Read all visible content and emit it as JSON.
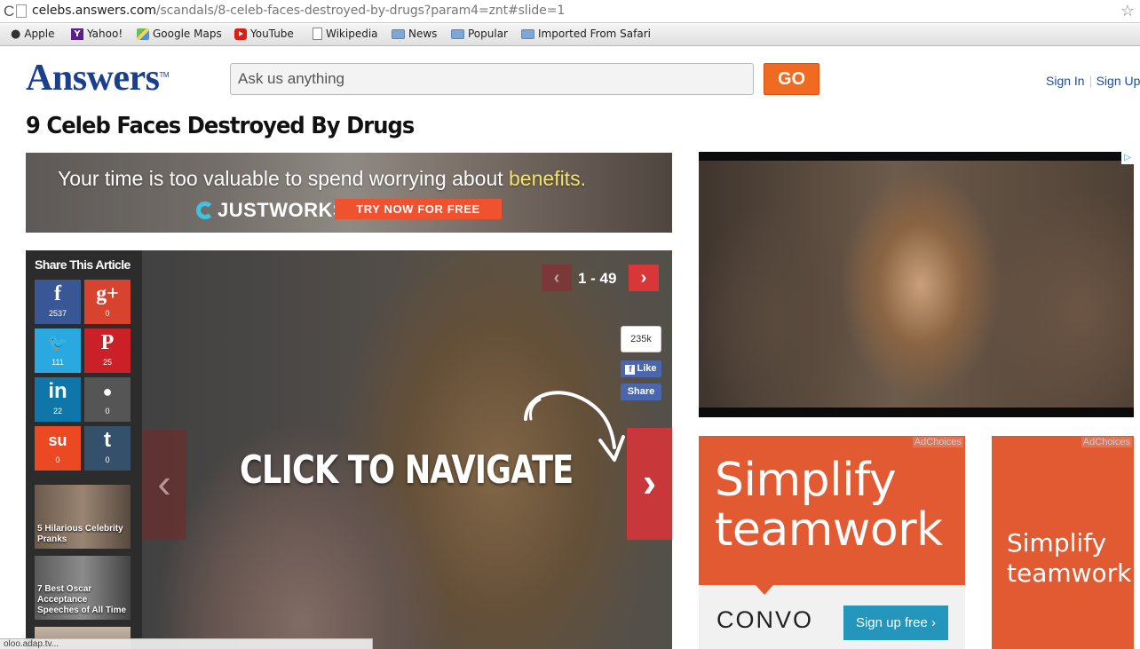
{
  "browser": {
    "url_host": "celebs.answers.com",
    "url_path": "/scandals/8-celeb-faces-destroyed-by-drugs?param4=znt#slide=1",
    "bookmarks": [
      {
        "label": "Apple",
        "icon": "apple-icon"
      },
      {
        "label": "Yahoo!",
        "icon": "yahoo-icon"
      },
      {
        "label": "Google Maps",
        "icon": "maps-icon"
      },
      {
        "label": "YouTube",
        "icon": "youtube-icon"
      },
      {
        "label": "Wikipedia",
        "icon": "page-icon"
      },
      {
        "label": "News",
        "icon": "folder-icon"
      },
      {
        "label": "Popular",
        "icon": "folder-icon"
      },
      {
        "label": "Imported From Safari",
        "icon": "folder-icon"
      }
    ],
    "status_text": "oloo.adap.tv..."
  },
  "header": {
    "logo": "Answers",
    "logo_tm": "TM",
    "search_placeholder": "Ask us anything",
    "go_label": "GO",
    "sign_in": "Sign In",
    "sign_up": "Sign Up"
  },
  "article": {
    "title": "9 Celeb Faces Destroyed By Drugs"
  },
  "banner_ad": {
    "headline_start": "Your time is too valuable to spend worrying about",
    "headline_highlight": "benefits.",
    "brand": "JUSTWORKS",
    "cta": "TRY NOW FOR FREE"
  },
  "slideshow": {
    "share_label": "Share This Article",
    "share": [
      {
        "name": "facebook",
        "glyph": "f",
        "count": "2537"
      },
      {
        "name": "google-plus",
        "glyph": "g+",
        "count": "0"
      },
      {
        "name": "twitter",
        "glyph": "🐦",
        "count": "111"
      },
      {
        "name": "pinterest",
        "glyph": "P",
        "count": "25"
      },
      {
        "name": "linkedin",
        "glyph": "in",
        "count": "22"
      },
      {
        "name": "reddit",
        "glyph": "●",
        "count": "0"
      },
      {
        "name": "stumbleupon",
        "glyph": "su",
        "count": "0"
      },
      {
        "name": "tumblr",
        "glyph": "t",
        "count": "0"
      }
    ],
    "related": [
      {
        "caption": "5 Hilarious Celebrity Pranks"
      },
      {
        "caption": "7 Best Oscar Acceptance Speeches of All Time"
      }
    ],
    "counter": "1 - 49",
    "prev_glyph": "‹",
    "next_glyph": "›",
    "fb_like_count": "235k",
    "fb_like_label": "Like",
    "fb_share_label": "Share",
    "overlay_text": "CLICK TO NAVIGATE"
  },
  "convo_ad": {
    "adchoices": "AdChoices",
    "headline_line1": "Simplify",
    "headline_line2": "teamwork",
    "brand": "CONVO",
    "cta": "Sign up free ›"
  },
  "convo_ad_small": {
    "adchoices": "AdChoices",
    "headline_line1": "Simplify",
    "headline_line2": "teamwork"
  },
  "colors": {
    "brand_blue": "#1b3f8f",
    "go_orange": "#f06a22",
    "nav_red": "#c8383b",
    "convo_orange": "#e25a32"
  }
}
